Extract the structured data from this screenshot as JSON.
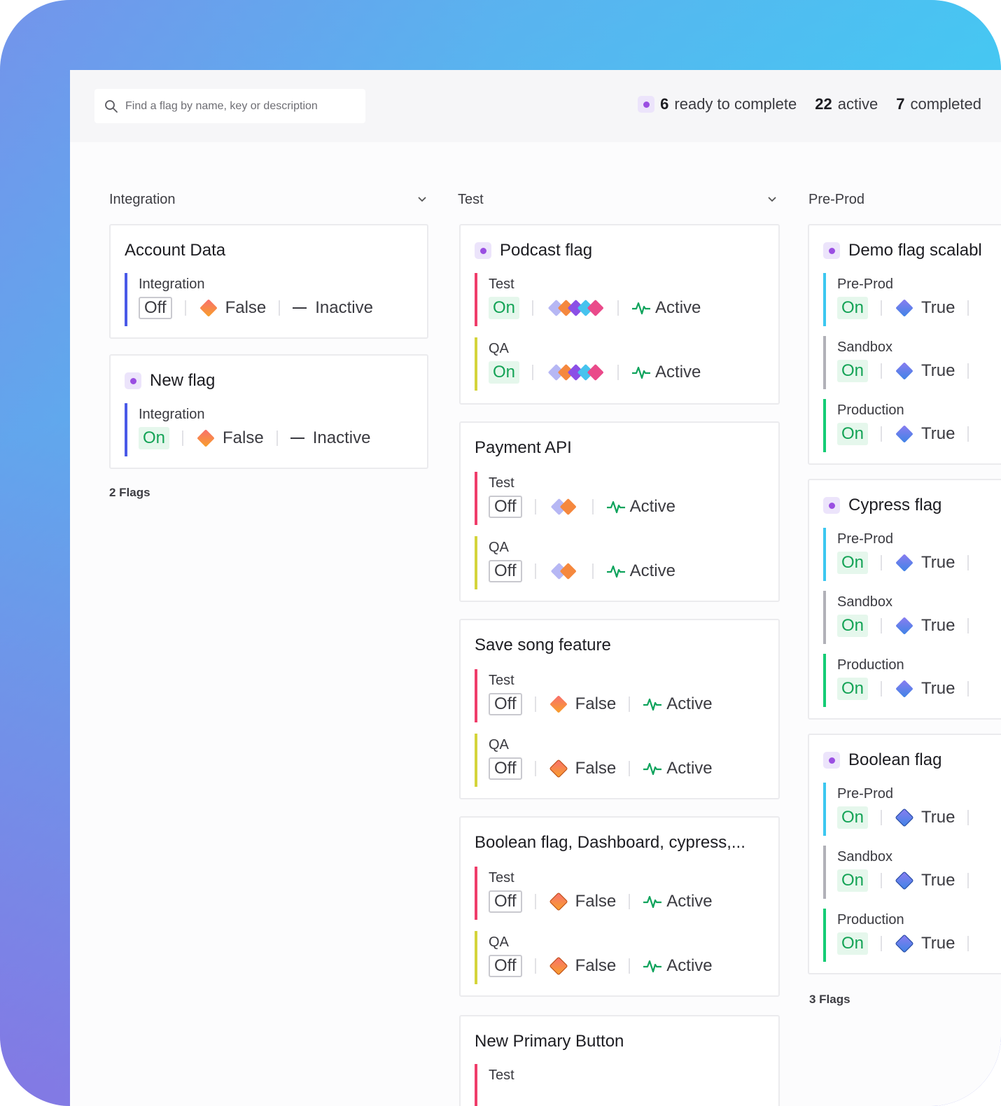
{
  "search": {
    "placeholder": "Find a flag by name, key or description"
  },
  "stats": {
    "ready_count": "6",
    "ready_label": "ready to complete",
    "active_count": "22",
    "active_label": "active",
    "completed_count": "7",
    "completed_label": "completed"
  },
  "colors": {
    "integration": "#4a5ae8",
    "test": "#ef3d6a",
    "qa": "#d4d43b",
    "preprod": "#3cc7f0",
    "sandbox": "#b1b1b8",
    "production": "#15cc75",
    "on_text": "#14a356",
    "active_green": "#0fa35c"
  },
  "columns": [
    {
      "title": "Integration",
      "footer": "2 Flags",
      "cards": [
        {
          "title": "Account Data",
          "envs": [
            {
              "name": "Integration",
              "toggle": "Off",
              "value": "False",
              "status": "Inactive"
            }
          ]
        },
        {
          "title": "New flag",
          "envs": [
            {
              "name": "Integration",
              "toggle": "On",
              "value": "False",
              "status": "Inactive"
            }
          ]
        }
      ]
    },
    {
      "title": "Test",
      "cards": [
        {
          "title": "Podcast flag",
          "envs": [
            {
              "name": "Test",
              "toggle": "On",
              "status": "Active"
            },
            {
              "name": "QA",
              "toggle": "On",
              "status": "Active"
            }
          ]
        },
        {
          "title": "Payment API",
          "envs": [
            {
              "name": "Test",
              "toggle": "Off",
              "status": "Active"
            },
            {
              "name": "QA",
              "toggle": "Off",
              "status": "Active"
            }
          ]
        },
        {
          "title": "Save song feature",
          "envs": [
            {
              "name": "Test",
              "toggle": "Off",
              "value": "False",
              "status": "Active"
            },
            {
              "name": "QA",
              "toggle": "Off",
              "value": "False",
              "status": "Active"
            }
          ]
        },
        {
          "title": "Boolean flag, Dashboard, cypress,...",
          "envs": [
            {
              "name": "Test",
              "toggle": "Off",
              "value": "False",
              "status": "Active"
            },
            {
              "name": "QA",
              "toggle": "Off",
              "value": "False",
              "status": "Active"
            }
          ]
        },
        {
          "title": "New Primary Button",
          "envs": [
            {
              "name": "Test"
            }
          ]
        }
      ]
    },
    {
      "title": "Pre-Prod",
      "footer": "3 Flags",
      "cards": [
        {
          "title": "Demo flag scalabl",
          "envs": [
            {
              "name": "Pre-Prod",
              "toggle": "On",
              "value": "True"
            },
            {
              "name": "Sandbox",
              "toggle": "On",
              "value": "True"
            },
            {
              "name": "Production",
              "toggle": "On",
              "value": "True"
            }
          ]
        },
        {
          "title": "Cypress flag",
          "envs": [
            {
              "name": "Pre-Prod",
              "toggle": "On",
              "value": "True"
            },
            {
              "name": "Sandbox",
              "toggle": "On",
              "value": "True"
            },
            {
              "name": "Production",
              "toggle": "On",
              "value": "True"
            }
          ]
        },
        {
          "title": "Boolean flag",
          "envs": [
            {
              "name": "Pre-Prod",
              "toggle": "On",
              "value": "True"
            },
            {
              "name": "Sandbox",
              "toggle": "On",
              "value": "True"
            },
            {
              "name": "Production",
              "toggle": "On",
              "value": "True"
            }
          ]
        }
      ]
    }
  ]
}
